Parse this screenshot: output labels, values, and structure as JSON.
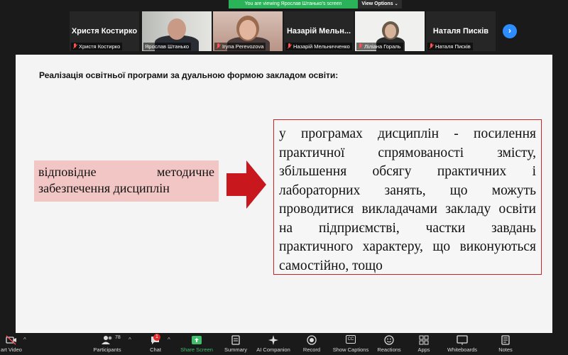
{
  "banner": {
    "viewing_text": "You are viewing Ярослав Штанько's screen",
    "options_label": "View Options",
    "options_caret": "⌄"
  },
  "participants": [
    {
      "display": "Христя Костирко",
      "name": "Христя Костирко",
      "video": false,
      "muted": true
    },
    {
      "display": "",
      "name": "Ярослав Штанько",
      "video": true,
      "muted": false
    },
    {
      "display": "",
      "name": "Iryna Perevozova",
      "video": true,
      "muted": true
    },
    {
      "display": "Назарій Мельн...",
      "name": "Назарій Мельничченко",
      "video": false,
      "muted": true
    },
    {
      "display": "",
      "name": "Ліліана Гораль",
      "video": true,
      "muted": true
    },
    {
      "display": "Наталя Писків",
      "name": "Наталя Писків",
      "video": false,
      "muted": true
    }
  ],
  "next_icon": "chevron-right-icon",
  "slide": {
    "title": "Реалізація освітньої програми за дуальною формою закладом освіти:",
    "left_text": "відповідне методичне забезпечення дисциплін",
    "right_text": "у програмах дисциплін - посилення практичної спрямованості змісту, збільшення обсягу практичних і лабораторних занять, що можуть проводитися викладачами закладу освіти на підприємстві, частки завдань практичного характеру, що виконуються самостійно, тощо",
    "arrow_color": "#c8171d",
    "left_box_color": "#f2c6c4",
    "right_border_color": "#cc2222"
  },
  "toolbar": {
    "start_video": "art Video",
    "participants": "Participants",
    "participants_count": "78",
    "chat": "Chat",
    "chat_badge": "1",
    "share_screen": "Share Screen",
    "summary": "Summary",
    "ai_companion": "AI Companion",
    "record": "Record",
    "show_captions": "Show Captions",
    "cc": "CC",
    "reactions": "Reactions",
    "apps": "Apps",
    "whiteboards": "Whiteboards",
    "notes": "Notes",
    "caret": "^"
  },
  "colors": {
    "banner_green": "#2bb35a",
    "share_green": "#3fbf6a",
    "accent_blue": "#2d8cff"
  }
}
